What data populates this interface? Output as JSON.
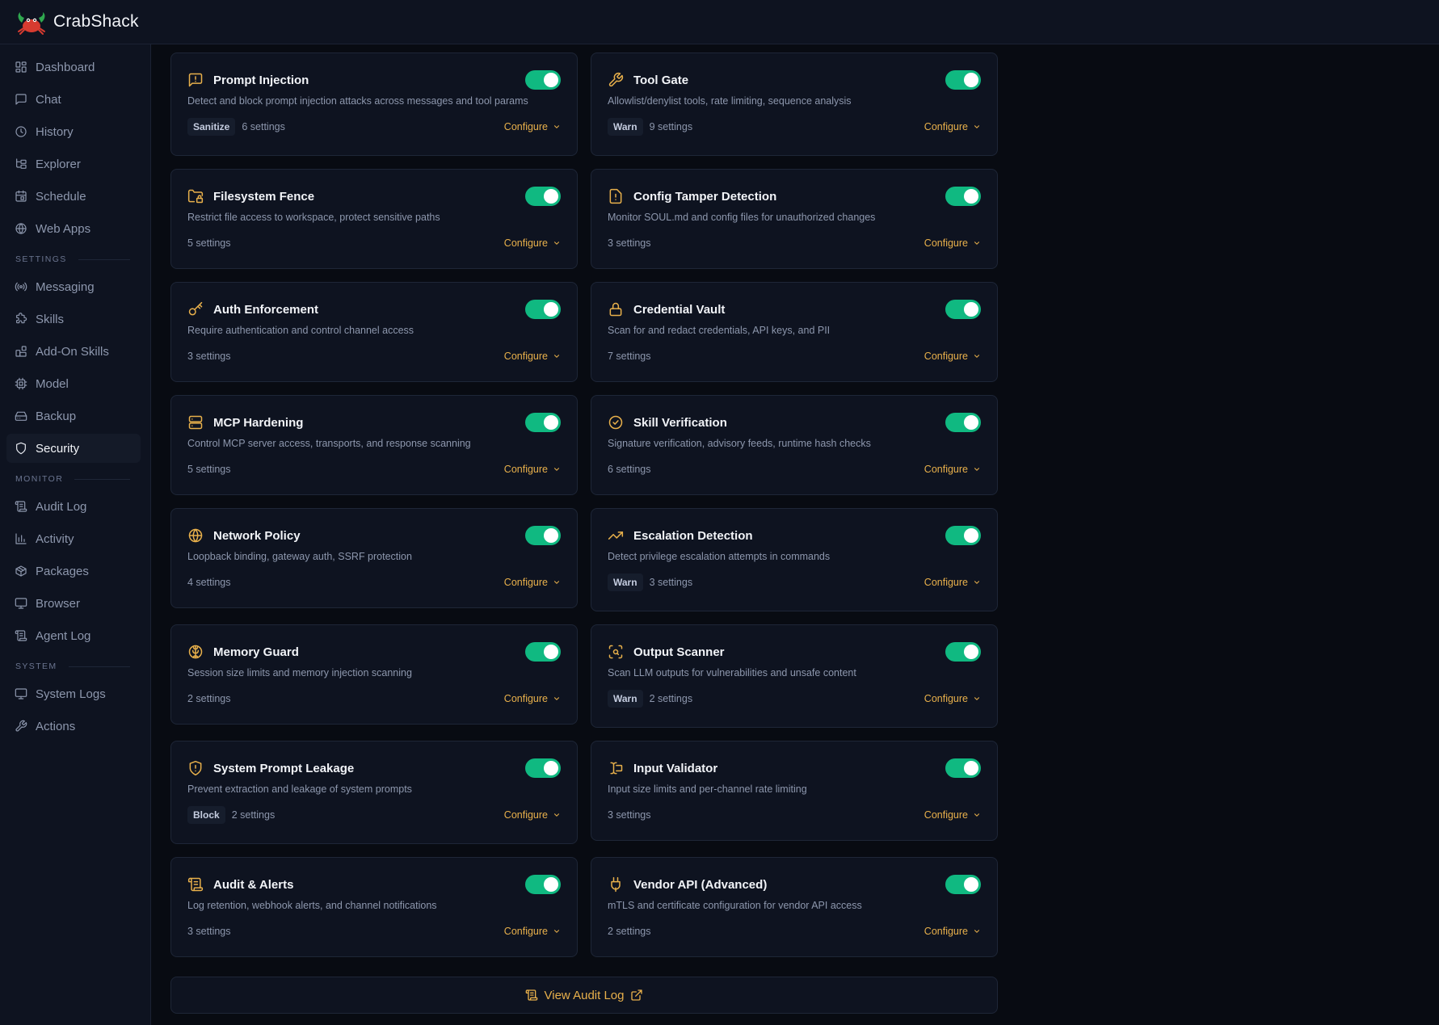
{
  "app": {
    "title": "CrabShack"
  },
  "sidebar": {
    "main": [
      {
        "label": "Dashboard",
        "icon": "dashboard-icon"
      },
      {
        "label": "Chat",
        "icon": "chat-icon"
      },
      {
        "label": "History",
        "icon": "clock-icon"
      },
      {
        "label": "Explorer",
        "icon": "folder-tree-icon"
      },
      {
        "label": "Schedule",
        "icon": "calendar-icon"
      },
      {
        "label": "Web Apps",
        "icon": "globe-icon"
      }
    ],
    "settings_label": "SETTINGS",
    "settings": [
      {
        "label": "Messaging",
        "icon": "radio-icon"
      },
      {
        "label": "Skills",
        "icon": "puzzle-icon"
      },
      {
        "label": "Add-On Skills",
        "icon": "blocks-icon"
      },
      {
        "label": "Model",
        "icon": "cpu-icon"
      },
      {
        "label": "Backup",
        "icon": "drive-icon"
      },
      {
        "label": "Security",
        "icon": "shield-icon"
      }
    ],
    "monitor_label": "MONITOR",
    "monitor": [
      {
        "label": "Audit Log",
        "icon": "scroll-icon"
      },
      {
        "label": "Activity",
        "icon": "bar-chart-icon"
      },
      {
        "label": "Packages",
        "icon": "package-icon"
      },
      {
        "label": "Browser",
        "icon": "monitor-icon"
      },
      {
        "label": "Agent Log",
        "icon": "scroll-icon"
      }
    ],
    "system_label": "SYSTEM",
    "system": [
      {
        "label": "System Logs",
        "icon": "monitor-icon"
      },
      {
        "label": "Actions",
        "icon": "wrench-icon"
      }
    ]
  },
  "configure_label": "Configure",
  "cards": [
    {
      "title": "Prompt Injection",
      "icon": "alert-message-icon",
      "desc": "Detect and block prompt injection attacks across messages and tool params",
      "badge": "Sanitize",
      "settings": "6 settings"
    },
    {
      "title": "Tool Gate",
      "icon": "wrench-icon",
      "desc": "Allowlist/denylist tools, rate limiting, sequence analysis",
      "badge": "Warn",
      "settings": "9 settings"
    },
    {
      "title": "Filesystem Fence",
      "icon": "folder-lock-icon",
      "desc": "Restrict file access to workspace, protect sensitive paths",
      "badge": "",
      "settings": "5 settings"
    },
    {
      "title": "Config Tamper Detection",
      "icon": "file-alert-icon",
      "desc": "Monitor SOUL.md and config files for unauthorized changes",
      "badge": "",
      "settings": "3 settings"
    },
    {
      "title": "Auth Enforcement",
      "icon": "key-icon",
      "desc": "Require authentication and control channel access",
      "badge": "",
      "settings": "3 settings"
    },
    {
      "title": "Credential Vault",
      "icon": "lock-icon",
      "desc": "Scan for and redact credentials, API keys, and PII",
      "badge": "",
      "settings": "7 settings"
    },
    {
      "title": "MCP Hardening",
      "icon": "server-icon",
      "desc": "Control MCP server access, transports, and response scanning",
      "badge": "",
      "settings": "5 settings"
    },
    {
      "title": "Skill Verification",
      "icon": "check-badge-icon",
      "desc": "Signature verification, advisory feeds, runtime hash checks",
      "badge": "",
      "settings": "6 settings"
    },
    {
      "title": "Network Policy",
      "icon": "globe-icon",
      "desc": "Loopback binding, gateway auth, SSRF protection",
      "badge": "",
      "settings": "4 settings"
    },
    {
      "title": "Escalation Detection",
      "icon": "trending-up-icon",
      "desc": "Detect privilege escalation attempts in commands",
      "badge": "Warn",
      "settings": "3 settings"
    },
    {
      "title": "Memory Guard",
      "icon": "brain-icon",
      "desc": "Session size limits and memory injection scanning",
      "badge": "",
      "settings": "2 settings"
    },
    {
      "title": "Output Scanner",
      "icon": "scan-search-icon",
      "desc": "Scan LLM outputs for vulnerabilities and unsafe content",
      "badge": "Warn",
      "settings": "2 settings"
    },
    {
      "title": "System Prompt Leakage",
      "icon": "shield-alert-icon",
      "desc": "Prevent extraction and leakage of system prompts",
      "badge": "Block",
      "settings": "2 settings"
    },
    {
      "title": "Input Validator",
      "icon": "text-cursor-icon",
      "desc": "Input size limits and per-channel rate limiting",
      "badge": "",
      "settings": "3 settings"
    },
    {
      "title": "Audit & Alerts",
      "icon": "scroll-icon",
      "desc": "Log retention, webhook alerts, and channel notifications",
      "badge": "",
      "settings": "3 settings"
    },
    {
      "title": "Vendor API (Advanced)",
      "icon": "plug-icon",
      "desc": "mTLS and certificate configuration for vendor API access",
      "badge": "",
      "settings": "2 settings"
    }
  ],
  "footer": {
    "label": "View Audit Log"
  },
  "colors": {
    "accent": "#e8b04b",
    "toggle_on": "#10b981",
    "bg": "#080b12",
    "panel": "#0e1320"
  }
}
